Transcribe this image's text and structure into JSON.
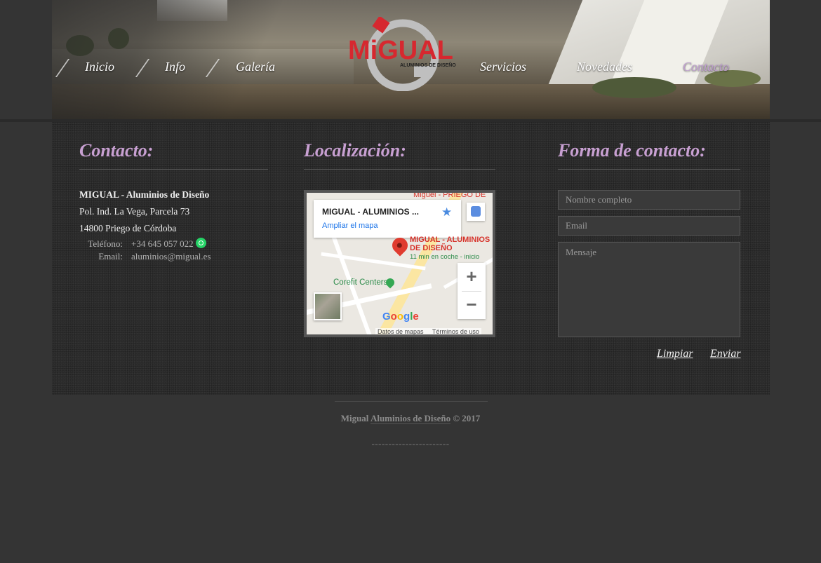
{
  "nav": {
    "items": [
      {
        "label": "Inicio"
      },
      {
        "label": "Info"
      },
      {
        "label": "Galería"
      },
      {
        "label": "Servicios"
      },
      {
        "label": "Novedades"
      },
      {
        "label": "Contacto"
      }
    ],
    "active_index": 5
  },
  "logo": {
    "brand": "MiGUAL",
    "tagline": "ALUMINIOS DE DISEÑO",
    "brand_color": "#d6282f"
  },
  "contact": {
    "title": "Contacto:",
    "company": "MIGUAL - Aluminios de Diseño",
    "address_line1": "Pol. Ind. La Vega, Parcela 73",
    "address_line2": "14800 Priego de Córdoba",
    "phone_label": "Teléfono:",
    "phone": "+34 645 057 022",
    "email_label": "Email:",
    "email": "aluminios@migual.es",
    "phone_icon": "whatsapp-icon"
  },
  "location": {
    "title": "Localización:",
    "map": {
      "place_title": "MIGUAL - ALUMINIOS ...",
      "expand_link": "Ampliar el mapa",
      "top_label": "Miguel - PRIEGO DE",
      "pin_label": "MIGUAL - ALUMINIOS DE DISEÑO",
      "pin_sub": "11 min en coche - inicio",
      "poi": "Corefit Centers",
      "google": "Google",
      "footer_data": "Datos de mapas",
      "footer_terms": "Términos de uso"
    }
  },
  "form": {
    "title": "Forma de contacto:",
    "name_placeholder": "Nombre completo",
    "email_placeholder": "Email",
    "message_placeholder": "Mensaje",
    "clear_label": "Limpiar",
    "send_label": "Enviar"
  },
  "footer": {
    "brand_prefix": "Migual ",
    "brand_link": "Aluminios de Diseño",
    "copyright": " © 2017",
    "dashes": "-----------------------"
  },
  "colors": {
    "accent_title": "#c8a0d2",
    "page_bg": "#343434"
  }
}
